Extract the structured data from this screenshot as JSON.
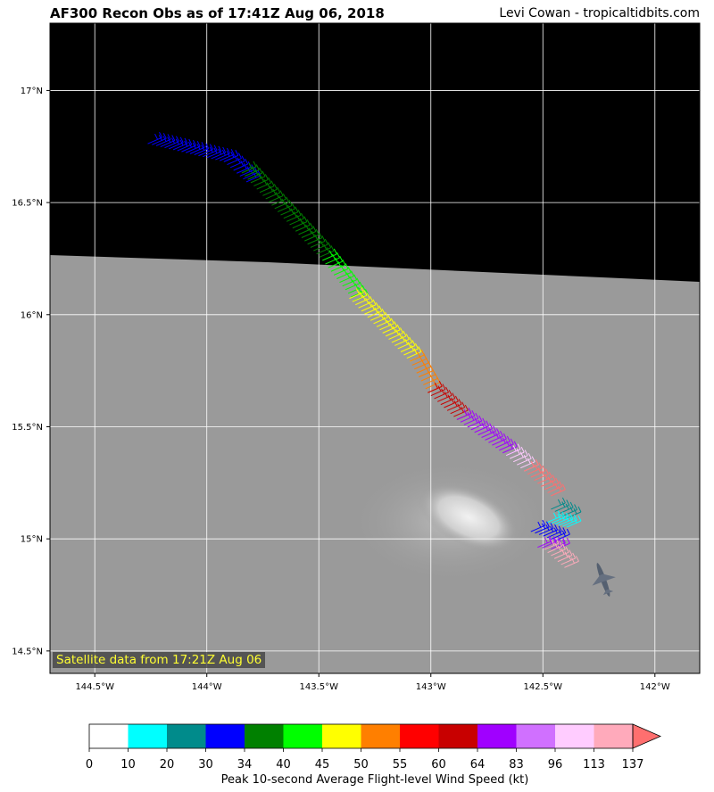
{
  "header": {
    "title": "AF300 Recon Obs as of 17:41Z Aug 06, 2018",
    "credit": "Levi Cowan - tropicaltidbits.com"
  },
  "map": {
    "lon_range": [
      -144.7,
      -141.8
    ],
    "lat_range": [
      14.4,
      17.3
    ],
    "lon_ticks": [
      {
        "value": -144.5,
        "label": "144.5°W"
      },
      {
        "value": -144.0,
        "label": "144°W"
      },
      {
        "value": -143.5,
        "label": "143.5°W"
      },
      {
        "value": -143.0,
        "label": "143°W"
      },
      {
        "value": -142.5,
        "label": "142.5°W"
      },
      {
        "value": -142.0,
        "label": "142°W"
      }
    ],
    "lat_ticks": [
      {
        "value": 17.0,
        "label": "17°N"
      },
      {
        "value": 16.5,
        "label": "16.5°N"
      },
      {
        "value": 16.0,
        "label": "16°N"
      },
      {
        "value": 15.5,
        "label": "15.5°N"
      },
      {
        "value": 15.0,
        "label": "15°N"
      },
      {
        "value": 14.5,
        "label": "14.5°N"
      }
    ],
    "satellite_note": "Satellite data from 17:21Z Aug 06",
    "aircraft_icon": "plane-icon"
  },
  "colorbar": {
    "label": "Peak 10-second Average Flight-level Wind Speed (kt)",
    "ticks": [
      "0",
      "10",
      "20",
      "30",
      "34",
      "40",
      "45",
      "50",
      "55",
      "60",
      "64",
      "83",
      "96",
      "113",
      "137"
    ],
    "colors": [
      "#ffffff",
      "#00ffff",
      "#008b8b",
      "#0000ff",
      "#008000",
      "#00ff00",
      "#ffff00",
      "#ff7f00",
      "#ff0000",
      "#c80000",
      "#a000ff",
      "#d070ff",
      "#ffccff",
      "#ffaabb",
      "#ff6f6f"
    ],
    "extend": "max"
  },
  "obs_segments": [
    {
      "color": "#0000ff",
      "from": [
        -144.2,
        16.79
      ],
      "to": [
        -143.86,
        16.71
      ]
    },
    {
      "color": "#0000ff",
      "from": [
        -143.86,
        16.71
      ],
      "to": [
        -143.76,
        16.62
      ]
    },
    {
      "color": "#008000",
      "from": [
        -143.78,
        16.66
      ],
      "to": [
        -143.42,
        16.27
      ]
    },
    {
      "color": "#00ff00",
      "from": [
        -143.42,
        16.27
      ],
      "to": [
        -143.28,
        16.09
      ]
    },
    {
      "color": "#ffff00",
      "from": [
        -143.3,
        16.1
      ],
      "to": [
        -143.03,
        15.82
      ]
    },
    {
      "color": "#ff7f00",
      "from": [
        -143.03,
        15.82
      ],
      "to": [
        -142.95,
        15.68
      ]
    },
    {
      "color": "#c80000",
      "from": [
        -142.95,
        15.68
      ],
      "to": [
        -142.82,
        15.56
      ]
    },
    {
      "color": "#a000ff",
      "from": [
        -142.82,
        15.56
      ],
      "to": [
        -142.6,
        15.4
      ]
    },
    {
      "color": "#ffccff",
      "from": [
        -142.6,
        15.4
      ],
      "to": [
        -142.52,
        15.33
      ]
    },
    {
      "color": "#ff6f6f",
      "from": [
        -142.52,
        15.33
      ],
      "to": [
        -142.4,
        15.22
      ]
    },
    {
      "color": "#008b8b",
      "from": [
        -142.4,
        15.16
      ],
      "to": [
        -142.33,
        15.12
      ]
    },
    {
      "color": "#00ffff",
      "from": [
        -142.42,
        15.1
      ],
      "to": [
        -142.33,
        15.08
      ]
    },
    {
      "color": "#0000ff",
      "from": [
        -142.49,
        15.06
      ],
      "to": [
        -142.38,
        15.02
      ]
    },
    {
      "color": "#a000ff",
      "from": [
        -142.46,
        14.99
      ],
      "to": [
        -142.38,
        14.98
      ]
    },
    {
      "color": "#ffaabb",
      "from": [
        -142.43,
        14.98
      ],
      "to": [
        -142.34,
        14.9
      ]
    }
  ]
}
